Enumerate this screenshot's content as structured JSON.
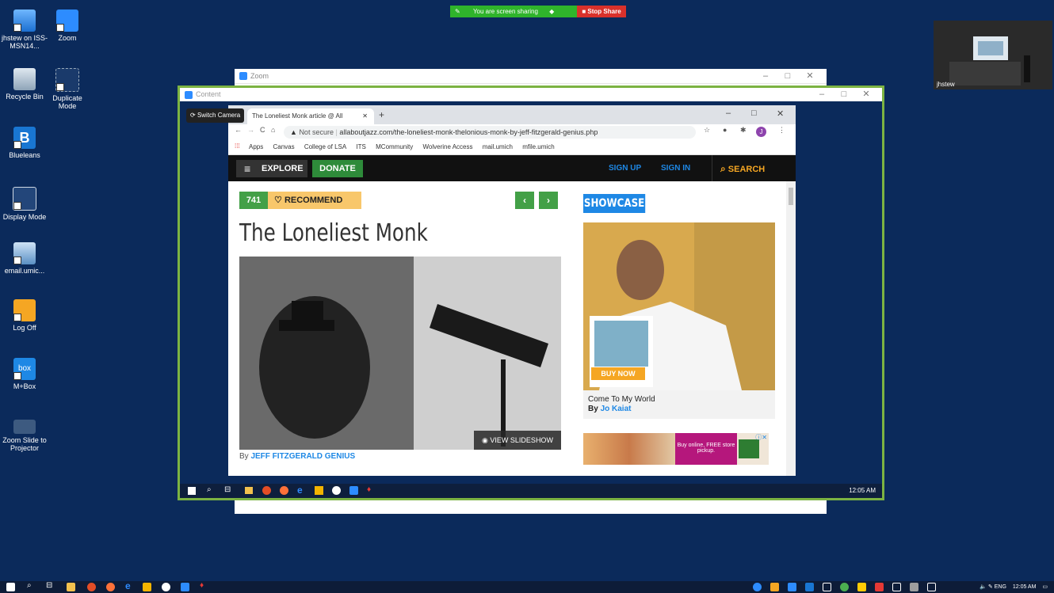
{
  "desktop": {
    "icons": [
      {
        "label": "jhstew on ISS-MSN14...",
        "icon": "computer-icon"
      },
      {
        "label": "Zoom",
        "icon": "zoom-icon"
      },
      {
        "label": "Recycle Bin",
        "icon": "recycle-bin-icon"
      },
      {
        "label": "Duplicate Mode",
        "icon": "duplicate-display-icon"
      },
      {
        "label": "Blueleans",
        "icon": "bluejeans-icon"
      },
      {
        "label": "Display Mode",
        "icon": "display-mode-icon"
      },
      {
        "label": "email.umic...",
        "icon": "email-icon"
      },
      {
        "label": "Log Off",
        "icon": "key-icon"
      },
      {
        "label": "M+Box",
        "icon": "box-icon"
      },
      {
        "label": "Zoom Slide to Projector",
        "icon": "projector-icon"
      }
    ]
  },
  "share_bar": {
    "status": "You are screen sharing",
    "stop_label": "Stop Share"
  },
  "camera": {
    "name": "jhstew"
  },
  "zoom_window": {
    "title": "Zoom"
  },
  "content_window": {
    "title": "Content",
    "switch_camera": "Switch Camera"
  },
  "browser": {
    "tab_title": "The Loneliest Monk article @ All",
    "security": "Not secure",
    "url": "allaboutjazz.com/the-loneliest-monk-thelonious-monk-by-jeff-fitzgerald-genius.php",
    "profile_initial": "J",
    "bookmarks": [
      "Apps",
      "Canvas",
      "College of LSA",
      "ITS",
      "MCommunity",
      "Wolverine Access",
      "mail.umich",
      "mfile.umich"
    ]
  },
  "site": {
    "explore": "EXPLORE",
    "donate": "DONATE",
    "sign_up": "SIGN UP",
    "sign_in": "SIGN IN",
    "search": "SEARCH",
    "recommend_count": "741",
    "recommend_label": "RECOMMEND",
    "article_title": "The Loneliest Monk",
    "view_slideshow": "VIEW SLIDESHOW",
    "byline_prefix": "By",
    "byline_author": "JEFF FITZGERALD GENIUS",
    "showcase": "SHOWCASE",
    "showcase_title": "Come To My World",
    "showcase_by": "By",
    "showcase_author": "Jo Kaiat",
    "buy_now": "BUY NOW",
    "ad_text": "Buy online, FREE store pickup."
  },
  "inner_taskbar": {
    "clock": "12:05 AM"
  },
  "taskbar": {
    "language": "ENG",
    "clock": "12:05 AM"
  },
  "colors": {
    "desktop": "#0b2a5b",
    "frame": "#7cb342",
    "share_green": "#2fb42b",
    "stop_red": "#d9312b"
  }
}
